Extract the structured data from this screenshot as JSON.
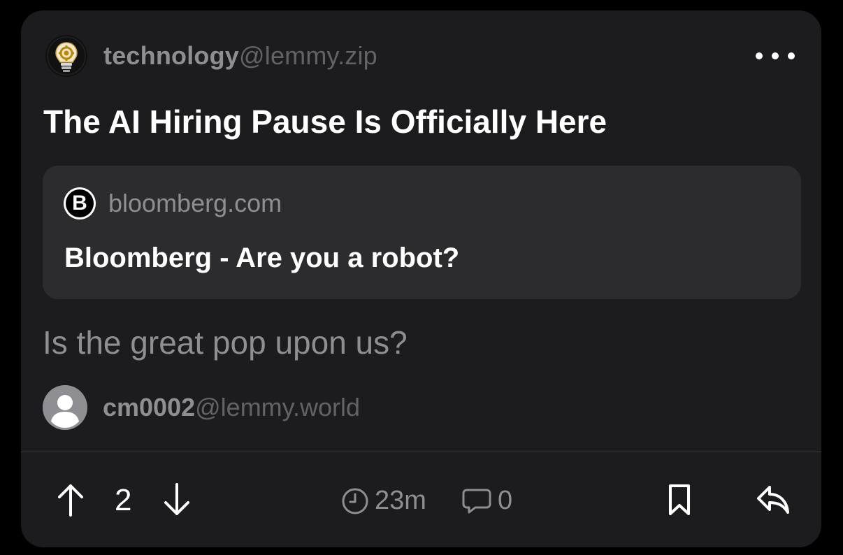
{
  "post": {
    "community": {
      "name": "technology",
      "instance": "@lemmy.zip",
      "avatar_icon": "lightbulb-gear-icon"
    },
    "title": "The AI Hiring Pause Is Officially Here",
    "link": {
      "favicon_letter": "B",
      "domain": "bloomberg.com",
      "title": "Bloomberg - Are you a robot?"
    },
    "body": "Is the great pop upon us?",
    "author": {
      "name": "cm0002",
      "instance": "@lemmy.world"
    },
    "actions": {
      "score": "2",
      "age": "23m",
      "comments": "0"
    }
  },
  "colors": {
    "background": "#000000",
    "card": "#1c1c1e",
    "link_card": "#2c2c2e",
    "secondary_text": "#8e8e93",
    "tertiary_text": "#636366",
    "divider": "#3a3a3c"
  }
}
